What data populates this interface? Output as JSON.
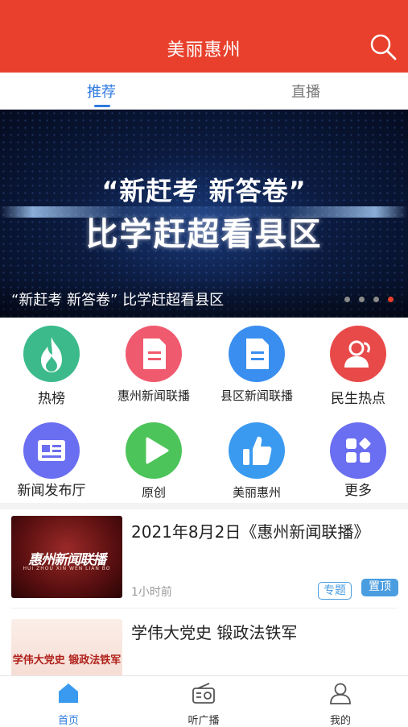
{
  "header": {
    "title": "美丽惠州",
    "search_icon": "search-icon"
  },
  "tabs": [
    {
      "label": "推荐",
      "active": true
    },
    {
      "label": "直播",
      "active": false
    }
  ],
  "banner": {
    "headline_line1": "“新赶考 新答卷”",
    "headline_line2": "比学赶超看县区",
    "caption": "“新赶考 新答卷” 比学赶超看县区",
    "pages": 4,
    "active_page": 4
  },
  "grid": [
    {
      "label": "热榜",
      "icon": "flame-icon",
      "color": "#3cba8c"
    },
    {
      "label": "惠州新闻联播",
      "icon": "document-icon",
      "color": "#f05a6e"
    },
    {
      "label": "县区新闻联播",
      "icon": "document-icon",
      "color": "#3a8ef0"
    },
    {
      "label": "民生热点",
      "icon": "people-icon",
      "color": "#e84a4a"
    },
    {
      "label": "新闻发布厅",
      "icon": "newspaper-icon",
      "color": "#6a6ef0"
    },
    {
      "label": "原创",
      "icon": "play-icon",
      "color": "#4cc45a"
    },
    {
      "label": "美丽惠州",
      "icon": "thumbs-up-icon",
      "color": "#3a9af0"
    },
    {
      "label": "更多",
      "icon": "apps-icon",
      "color": "#6a6ef0"
    }
  ],
  "news": [
    {
      "title": "2021年8月2日《惠州新闻联播》",
      "time": "1小时前",
      "thumb_text": "惠州新闻联播",
      "thumb_sub": "HUI ZHOU XIN WEN LIAN BO",
      "tags": [
        "专题",
        "置顶"
      ]
    },
    {
      "title": "学伟大党史 锻政法铁军",
      "thumb_text": "学伟大党史  锻政法铁军"
    }
  ],
  "bottom_nav": [
    {
      "label": "首页",
      "icon": "home-icon",
      "active": true
    },
    {
      "label": "听广播",
      "icon": "radio-icon",
      "active": false
    },
    {
      "label": "我的",
      "icon": "user-icon",
      "active": false
    }
  ],
  "colors": {
    "brand_red": "#e8402c",
    "accent_blue": "#2e7ae0",
    "tag_blue": "#4a9de0"
  }
}
